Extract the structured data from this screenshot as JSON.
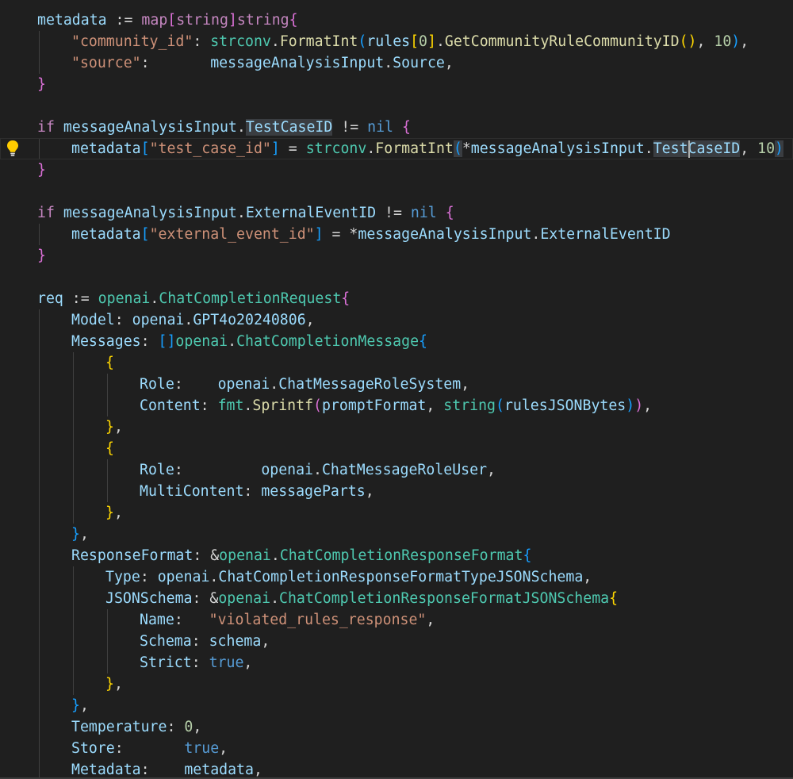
{
  "editor": {
    "language": "go",
    "colors": {
      "background": "#1f1f1f",
      "keyword": "#c586c0",
      "variable": "#9cdcfe",
      "string": "#ce9178",
      "number": "#b5cea8",
      "type": "#4ec9b0",
      "function": "#dcdcaa",
      "bracket_gold": "#ffd700",
      "bracket_purple": "#da70d6",
      "bracket_blue": "#179fff",
      "plain": "#d4d4d4",
      "constant": "#569cd6"
    },
    "lightbulb_icon": "lightbulb-icon",
    "lines": [
      {
        "indent": 0,
        "tokens": [
          [
            "metadata",
            "v"
          ],
          [
            " := ",
            "o"
          ],
          [
            "map",
            "kw"
          ],
          [
            "[",
            "bp"
          ],
          [
            "string",
            "kw"
          ],
          [
            "]",
            "bp"
          ],
          [
            "string",
            "kw"
          ],
          [
            "{",
            "bp"
          ]
        ]
      },
      {
        "indent": 1,
        "tokens": [
          [
            "\"community_id\"",
            "s"
          ],
          [
            ": ",
            "o"
          ],
          [
            "strconv",
            "t"
          ],
          [
            ".",
            "o"
          ],
          [
            "FormatInt",
            "f"
          ],
          [
            "(",
            "bb"
          ],
          [
            "rules",
            "v"
          ],
          [
            "[",
            "bg"
          ],
          [
            "0",
            "n"
          ],
          [
            "]",
            "bg"
          ],
          [
            ".",
            "o"
          ],
          [
            "GetCommunityRuleCommunityID",
            "f"
          ],
          [
            "(",
            "bg"
          ],
          [
            ")",
            "bg"
          ],
          [
            ", ",
            "o"
          ],
          [
            "10",
            "n"
          ],
          [
            ")",
            "bb"
          ],
          [
            ",",
            "o"
          ]
        ]
      },
      {
        "indent": 1,
        "tokens": [
          [
            "\"source\"",
            "s"
          ],
          [
            ":       ",
            "o"
          ],
          [
            "messageAnalysisInput",
            "v"
          ],
          [
            ".",
            "o"
          ],
          [
            "Source",
            "v"
          ],
          [
            ",",
            "o"
          ]
        ]
      },
      {
        "indent": 0,
        "tokens": [
          [
            "}",
            "bp"
          ]
        ]
      },
      {
        "indent": 0,
        "tokens": []
      },
      {
        "indent": 0,
        "tokens": [
          [
            "if",
            "kw"
          ],
          [
            " ",
            "o"
          ],
          [
            "messageAnalysisInput",
            "v"
          ],
          [
            ".",
            "o"
          ],
          [
            "TestCaseID",
            "vh"
          ],
          [
            " != ",
            "o"
          ],
          [
            "nil",
            "c"
          ],
          [
            " ",
            "o"
          ],
          [
            "{",
            "bp"
          ]
        ]
      },
      {
        "indent": 1,
        "active": true,
        "tokens": [
          [
            "metadata",
            "v"
          ],
          [
            "[",
            "bb"
          ],
          [
            "\"test_case_id\"",
            "s"
          ],
          [
            "]",
            "bb"
          ],
          [
            " = ",
            "o"
          ],
          [
            "strconv",
            "t"
          ],
          [
            ".",
            "o"
          ],
          [
            "FormatInt",
            "f"
          ],
          [
            "(",
            "bbh"
          ],
          [
            "*",
            "o"
          ],
          [
            "messageAnalysisInput",
            "v"
          ],
          [
            ".",
            "o"
          ],
          [
            "TestCaseID",
            "vh"
          ],
          [
            ", ",
            "o"
          ],
          [
            "10",
            "n"
          ],
          [
            ")",
            "bbh"
          ]
        ]
      },
      {
        "indent": 0,
        "tokens": [
          [
            "}",
            "bp"
          ]
        ]
      },
      {
        "indent": 0,
        "tokens": []
      },
      {
        "indent": 0,
        "tokens": [
          [
            "if",
            "kw"
          ],
          [
            " ",
            "o"
          ],
          [
            "messageAnalysisInput",
            "v"
          ],
          [
            ".",
            "o"
          ],
          [
            "ExternalEventID",
            "v"
          ],
          [
            " != ",
            "o"
          ],
          [
            "nil",
            "c"
          ],
          [
            " ",
            "o"
          ],
          [
            "{",
            "bp"
          ]
        ]
      },
      {
        "indent": 1,
        "tokens": [
          [
            "metadata",
            "v"
          ],
          [
            "[",
            "bb"
          ],
          [
            "\"external_event_id\"",
            "s"
          ],
          [
            "]",
            "bb"
          ],
          [
            " = ",
            "o"
          ],
          [
            "*",
            "o"
          ],
          [
            "messageAnalysisInput",
            "v"
          ],
          [
            ".",
            "o"
          ],
          [
            "ExternalEventID",
            "v"
          ]
        ]
      },
      {
        "indent": 0,
        "tokens": [
          [
            "}",
            "bp"
          ]
        ]
      },
      {
        "indent": 0,
        "tokens": []
      },
      {
        "indent": 0,
        "tokens": [
          [
            "req",
            "v"
          ],
          [
            " := ",
            "o"
          ],
          [
            "openai",
            "t"
          ],
          [
            ".",
            "o"
          ],
          [
            "ChatCompletionRequest",
            "t"
          ],
          [
            "{",
            "bp"
          ]
        ]
      },
      {
        "indent": 1,
        "tokens": [
          [
            "Model",
            "v"
          ],
          [
            ": ",
            "o"
          ],
          [
            "openai",
            "v"
          ],
          [
            ".",
            "o"
          ],
          [
            "GPT4o20240806",
            "v"
          ],
          [
            ",",
            "o"
          ]
        ]
      },
      {
        "indent": 1,
        "tokens": [
          [
            "Messages",
            "v"
          ],
          [
            ": ",
            "o"
          ],
          [
            "[]",
            "bb"
          ],
          [
            "openai",
            "t"
          ],
          [
            ".",
            "o"
          ],
          [
            "ChatCompletionMessage",
            "t"
          ],
          [
            "{",
            "bb"
          ]
        ]
      },
      {
        "indent": 2,
        "tokens": [
          [
            "{",
            "bg"
          ]
        ]
      },
      {
        "indent": 3,
        "tokens": [
          [
            "Role",
            "v"
          ],
          [
            ":    ",
            "o"
          ],
          [
            "openai",
            "v"
          ],
          [
            ".",
            "o"
          ],
          [
            "ChatMessageRoleSystem",
            "v"
          ],
          [
            ",",
            "o"
          ]
        ]
      },
      {
        "indent": 3,
        "tokens": [
          [
            "Content",
            "v"
          ],
          [
            ": ",
            "o"
          ],
          [
            "fmt",
            "t"
          ],
          [
            ".",
            "o"
          ],
          [
            "Sprintf",
            "f"
          ],
          [
            "(",
            "bp"
          ],
          [
            "promptFormat",
            "v"
          ],
          [
            ", ",
            "o"
          ],
          [
            "string",
            "t"
          ],
          [
            "(",
            "bb"
          ],
          [
            "rulesJSONBytes",
            "v"
          ],
          [
            ")",
            "bb"
          ],
          [
            ")",
            "bp"
          ],
          [
            ",",
            "o"
          ]
        ]
      },
      {
        "indent": 2,
        "tokens": [
          [
            "}",
            "bg"
          ],
          [
            ",",
            "o"
          ]
        ]
      },
      {
        "indent": 2,
        "tokens": [
          [
            "{",
            "bg"
          ]
        ]
      },
      {
        "indent": 3,
        "tokens": [
          [
            "Role",
            "v"
          ],
          [
            ":         ",
            "o"
          ],
          [
            "openai",
            "v"
          ],
          [
            ".",
            "o"
          ],
          [
            "ChatMessageRoleUser",
            "v"
          ],
          [
            ",",
            "o"
          ]
        ]
      },
      {
        "indent": 3,
        "tokens": [
          [
            "MultiContent",
            "v"
          ],
          [
            ": ",
            "o"
          ],
          [
            "messageParts",
            "v"
          ],
          [
            ",",
            "o"
          ]
        ]
      },
      {
        "indent": 2,
        "tokens": [
          [
            "}",
            "bg"
          ],
          [
            ",",
            "o"
          ]
        ]
      },
      {
        "indent": 1,
        "tokens": [
          [
            "}",
            "bb"
          ],
          [
            ",",
            "o"
          ]
        ]
      },
      {
        "indent": 1,
        "tokens": [
          [
            "ResponseFormat",
            "v"
          ],
          [
            ": ",
            "o"
          ],
          [
            "&",
            "o"
          ],
          [
            "openai",
            "t"
          ],
          [
            ".",
            "o"
          ],
          [
            "ChatCompletionResponseFormat",
            "t"
          ],
          [
            "{",
            "bb"
          ]
        ]
      },
      {
        "indent": 2,
        "tokens": [
          [
            "Type",
            "v"
          ],
          [
            ": ",
            "o"
          ],
          [
            "openai",
            "v"
          ],
          [
            ".",
            "o"
          ],
          [
            "ChatCompletionResponseFormatTypeJSONSchema",
            "v"
          ],
          [
            ",",
            "o"
          ]
        ]
      },
      {
        "indent": 2,
        "tokens": [
          [
            "JSONSchema",
            "v"
          ],
          [
            ": ",
            "o"
          ],
          [
            "&",
            "o"
          ],
          [
            "openai",
            "t"
          ],
          [
            ".",
            "o"
          ],
          [
            "ChatCompletionResponseFormatJSONSchema",
            "t"
          ],
          [
            "{",
            "bg"
          ]
        ]
      },
      {
        "indent": 3,
        "tokens": [
          [
            "Name",
            "v"
          ],
          [
            ":   ",
            "o"
          ],
          [
            "\"violated_rules_response\"",
            "s"
          ],
          [
            ",",
            "o"
          ]
        ]
      },
      {
        "indent": 3,
        "tokens": [
          [
            "Schema",
            "v"
          ],
          [
            ": ",
            "o"
          ],
          [
            "schema",
            "v"
          ],
          [
            ",",
            "o"
          ]
        ]
      },
      {
        "indent": 3,
        "tokens": [
          [
            "Strict",
            "v"
          ],
          [
            ": ",
            "o"
          ],
          [
            "true",
            "c"
          ],
          [
            ",",
            "o"
          ]
        ]
      },
      {
        "indent": 2,
        "tokens": [
          [
            "}",
            "bg"
          ],
          [
            ",",
            "o"
          ]
        ]
      },
      {
        "indent": 1,
        "tokens": [
          [
            "}",
            "bb"
          ],
          [
            ",",
            "o"
          ]
        ]
      },
      {
        "indent": 1,
        "tokens": [
          [
            "Temperature",
            "v"
          ],
          [
            ": ",
            "o"
          ],
          [
            "0",
            "n"
          ],
          [
            ",",
            "o"
          ]
        ]
      },
      {
        "indent": 1,
        "tokens": [
          [
            "Store",
            "v"
          ],
          [
            ":       ",
            "o"
          ],
          [
            "true",
            "c"
          ],
          [
            ",",
            "o"
          ]
        ]
      },
      {
        "indent": 1,
        "tokens": [
          [
            "Metadata",
            "v"
          ],
          [
            ":    ",
            "o"
          ],
          [
            "metadata",
            "v"
          ],
          [
            ",",
            "o"
          ]
        ]
      }
    ]
  }
}
